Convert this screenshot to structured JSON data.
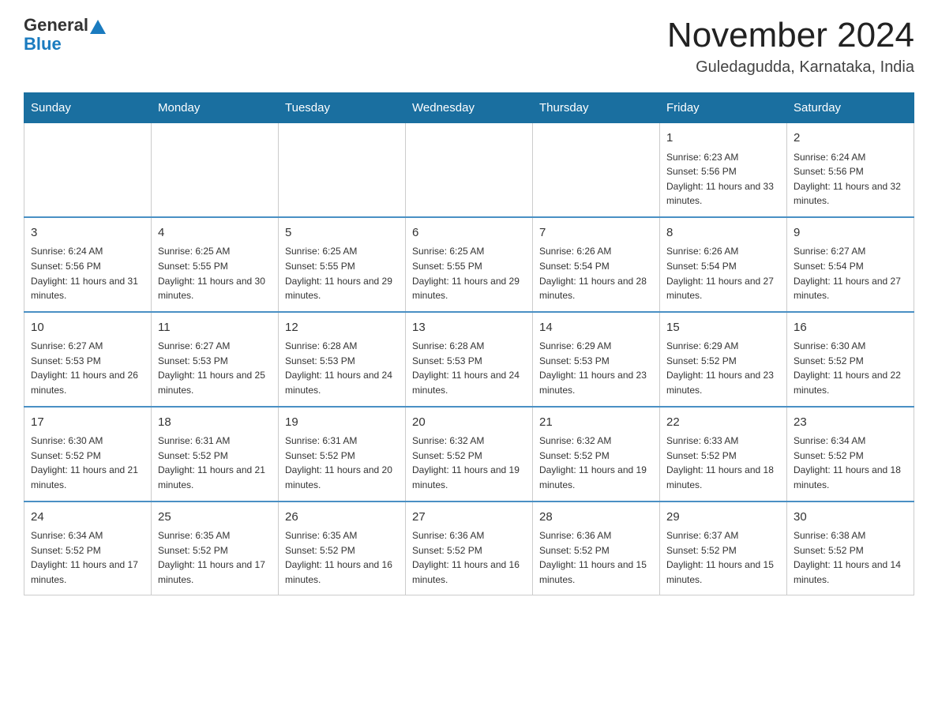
{
  "header": {
    "logo_text_general": "General",
    "logo_text_blue": "Blue",
    "month_title": "November 2024",
    "location": "Guledagudda, Karnataka, India"
  },
  "days_of_week": [
    "Sunday",
    "Monday",
    "Tuesday",
    "Wednesday",
    "Thursday",
    "Friday",
    "Saturday"
  ],
  "weeks": [
    [
      {
        "day": "",
        "sunrise": "",
        "sunset": "",
        "daylight": ""
      },
      {
        "day": "",
        "sunrise": "",
        "sunset": "",
        "daylight": ""
      },
      {
        "day": "",
        "sunrise": "",
        "sunset": "",
        "daylight": ""
      },
      {
        "day": "",
        "sunrise": "",
        "sunset": "",
        "daylight": ""
      },
      {
        "day": "",
        "sunrise": "",
        "sunset": "",
        "daylight": ""
      },
      {
        "day": "1",
        "sunrise": "Sunrise: 6:23 AM",
        "sunset": "Sunset: 5:56 PM",
        "daylight": "Daylight: 11 hours and 33 minutes."
      },
      {
        "day": "2",
        "sunrise": "Sunrise: 6:24 AM",
        "sunset": "Sunset: 5:56 PM",
        "daylight": "Daylight: 11 hours and 32 minutes."
      }
    ],
    [
      {
        "day": "3",
        "sunrise": "Sunrise: 6:24 AM",
        "sunset": "Sunset: 5:56 PM",
        "daylight": "Daylight: 11 hours and 31 minutes."
      },
      {
        "day": "4",
        "sunrise": "Sunrise: 6:25 AM",
        "sunset": "Sunset: 5:55 PM",
        "daylight": "Daylight: 11 hours and 30 minutes."
      },
      {
        "day": "5",
        "sunrise": "Sunrise: 6:25 AM",
        "sunset": "Sunset: 5:55 PM",
        "daylight": "Daylight: 11 hours and 29 minutes."
      },
      {
        "day": "6",
        "sunrise": "Sunrise: 6:25 AM",
        "sunset": "Sunset: 5:55 PM",
        "daylight": "Daylight: 11 hours and 29 minutes."
      },
      {
        "day": "7",
        "sunrise": "Sunrise: 6:26 AM",
        "sunset": "Sunset: 5:54 PM",
        "daylight": "Daylight: 11 hours and 28 minutes."
      },
      {
        "day": "8",
        "sunrise": "Sunrise: 6:26 AM",
        "sunset": "Sunset: 5:54 PM",
        "daylight": "Daylight: 11 hours and 27 minutes."
      },
      {
        "day": "9",
        "sunrise": "Sunrise: 6:27 AM",
        "sunset": "Sunset: 5:54 PM",
        "daylight": "Daylight: 11 hours and 27 minutes."
      }
    ],
    [
      {
        "day": "10",
        "sunrise": "Sunrise: 6:27 AM",
        "sunset": "Sunset: 5:53 PM",
        "daylight": "Daylight: 11 hours and 26 minutes."
      },
      {
        "day": "11",
        "sunrise": "Sunrise: 6:27 AM",
        "sunset": "Sunset: 5:53 PM",
        "daylight": "Daylight: 11 hours and 25 minutes."
      },
      {
        "day": "12",
        "sunrise": "Sunrise: 6:28 AM",
        "sunset": "Sunset: 5:53 PM",
        "daylight": "Daylight: 11 hours and 24 minutes."
      },
      {
        "day": "13",
        "sunrise": "Sunrise: 6:28 AM",
        "sunset": "Sunset: 5:53 PM",
        "daylight": "Daylight: 11 hours and 24 minutes."
      },
      {
        "day": "14",
        "sunrise": "Sunrise: 6:29 AM",
        "sunset": "Sunset: 5:53 PM",
        "daylight": "Daylight: 11 hours and 23 minutes."
      },
      {
        "day": "15",
        "sunrise": "Sunrise: 6:29 AM",
        "sunset": "Sunset: 5:52 PM",
        "daylight": "Daylight: 11 hours and 23 minutes."
      },
      {
        "day": "16",
        "sunrise": "Sunrise: 6:30 AM",
        "sunset": "Sunset: 5:52 PM",
        "daylight": "Daylight: 11 hours and 22 minutes."
      }
    ],
    [
      {
        "day": "17",
        "sunrise": "Sunrise: 6:30 AM",
        "sunset": "Sunset: 5:52 PM",
        "daylight": "Daylight: 11 hours and 21 minutes."
      },
      {
        "day": "18",
        "sunrise": "Sunrise: 6:31 AM",
        "sunset": "Sunset: 5:52 PM",
        "daylight": "Daylight: 11 hours and 21 minutes."
      },
      {
        "day": "19",
        "sunrise": "Sunrise: 6:31 AM",
        "sunset": "Sunset: 5:52 PM",
        "daylight": "Daylight: 11 hours and 20 minutes."
      },
      {
        "day": "20",
        "sunrise": "Sunrise: 6:32 AM",
        "sunset": "Sunset: 5:52 PM",
        "daylight": "Daylight: 11 hours and 19 minutes."
      },
      {
        "day": "21",
        "sunrise": "Sunrise: 6:32 AM",
        "sunset": "Sunset: 5:52 PM",
        "daylight": "Daylight: 11 hours and 19 minutes."
      },
      {
        "day": "22",
        "sunrise": "Sunrise: 6:33 AM",
        "sunset": "Sunset: 5:52 PM",
        "daylight": "Daylight: 11 hours and 18 minutes."
      },
      {
        "day": "23",
        "sunrise": "Sunrise: 6:34 AM",
        "sunset": "Sunset: 5:52 PM",
        "daylight": "Daylight: 11 hours and 18 minutes."
      }
    ],
    [
      {
        "day": "24",
        "sunrise": "Sunrise: 6:34 AM",
        "sunset": "Sunset: 5:52 PM",
        "daylight": "Daylight: 11 hours and 17 minutes."
      },
      {
        "day": "25",
        "sunrise": "Sunrise: 6:35 AM",
        "sunset": "Sunset: 5:52 PM",
        "daylight": "Daylight: 11 hours and 17 minutes."
      },
      {
        "day": "26",
        "sunrise": "Sunrise: 6:35 AM",
        "sunset": "Sunset: 5:52 PM",
        "daylight": "Daylight: 11 hours and 16 minutes."
      },
      {
        "day": "27",
        "sunrise": "Sunrise: 6:36 AM",
        "sunset": "Sunset: 5:52 PM",
        "daylight": "Daylight: 11 hours and 16 minutes."
      },
      {
        "day": "28",
        "sunrise": "Sunrise: 6:36 AM",
        "sunset": "Sunset: 5:52 PM",
        "daylight": "Daylight: 11 hours and 15 minutes."
      },
      {
        "day": "29",
        "sunrise": "Sunrise: 6:37 AM",
        "sunset": "Sunset: 5:52 PM",
        "daylight": "Daylight: 11 hours and 15 minutes."
      },
      {
        "day": "30",
        "sunrise": "Sunrise: 6:38 AM",
        "sunset": "Sunset: 5:52 PM",
        "daylight": "Daylight: 11 hours and 14 minutes."
      }
    ]
  ]
}
